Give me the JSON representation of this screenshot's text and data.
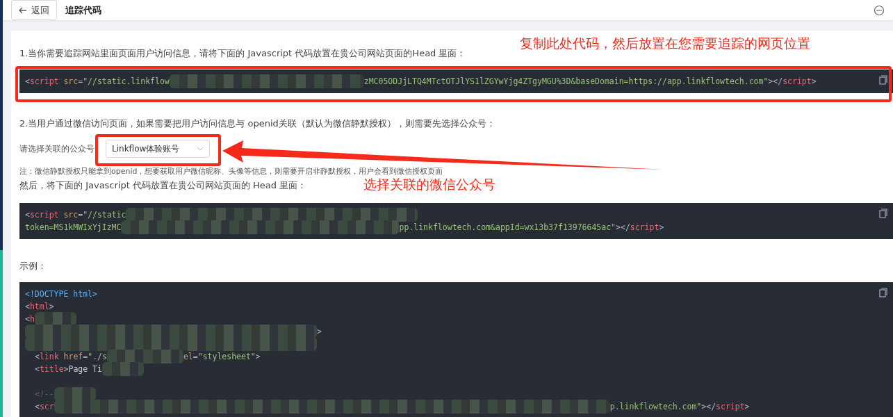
{
  "header": {
    "back_label": "返回",
    "title": "追踪代码"
  },
  "step1": {
    "text": "1.当你需要追踪网站里面页面用户访问信息，请将下面的 Javascript 代码放置在贵公司网站页面的Head 里面：",
    "code": [
      [
        {
          "kind": "punct",
          "text": "<"
        },
        {
          "kind": "tag",
          "text": "script"
        },
        {
          "kind": "attr",
          "text": " src"
        },
        {
          "kind": "punct",
          "text": "="
        },
        {
          "kind": "string",
          "text": "\"//static.linkflow"
        },
        {
          "kind": "redacted"
        },
        {
          "kind": "string",
          "text": "zMC05ODJjLTQ4MTctOTJlYS1lZGYwYjg4ZTgyMGU%3D&baseDomain=https://app.linkflowtech.com\""
        },
        {
          "kind": "punct",
          "text": "></"
        },
        {
          "kind": "tag",
          "text": "script"
        },
        {
          "kind": "punct",
          "text": ">"
        }
      ]
    ]
  },
  "step2": {
    "text": "2.当用户通过微信访问页面，如果需要把用户访问信息与 openid关联（默认为微信静默授权），则需要先选择公众号：",
    "select_label": "请选择关联的公众号",
    "select_value": "Linkflow体验账号",
    "note": "注：微信静默授权只能拿到openid，想要获取用户微信昵称、头像等信息，则需要开启非静默授权，用户会看到微信授权页面",
    "then": "然后，将下面的 Javascript 代码放置在贵公司网站页面的 Head 里面：",
    "code": [
      [
        {
          "kind": "punct",
          "text": "<"
        },
        {
          "kind": "tag",
          "text": "script"
        },
        {
          "kind": "attr",
          "text": " src"
        },
        {
          "kind": "punct",
          "text": "="
        },
        {
          "kind": "string",
          "text": "\"//static"
        },
        {
          "kind": "redacted"
        }
      ],
      [
        {
          "kind": "string",
          "text": "token=MS1kMWIxYjIzMC"
        },
        {
          "kind": "redacted"
        },
        {
          "kind": "string",
          "text": "pp.linkflowtech.com&appId=wx13b37f13976645ac\""
        },
        {
          "kind": "punct",
          "text": "></"
        },
        {
          "kind": "tag",
          "text": "script"
        },
        {
          "kind": "punct",
          "text": ">"
        }
      ]
    ]
  },
  "example": {
    "label": "示例：",
    "code": [
      [
        {
          "kind": "doctype",
          "text": "<!DOCTYPE html>"
        }
      ],
      [
        {
          "kind": "punct",
          "text": "<"
        },
        {
          "kind": "tag",
          "text": "html"
        },
        {
          "kind": "punct",
          "text": ">"
        }
      ],
      [
        {
          "kind": "punct",
          "text": "<"
        },
        {
          "kind": "tag",
          "text": "h"
        },
        {
          "kind": "redacted"
        }
      ],
      [
        {
          "kind": "redacted"
        },
        {
          "kind": "punct",
          "text": ">"
        }
      ],
      [
        {
          "kind": "redacted"
        }
      ],
      [
        {
          "kind": "indent"
        },
        {
          "kind": "punct",
          "text": "<"
        },
        {
          "kind": "tag",
          "text": "link"
        },
        {
          "kind": "attr",
          "text": " href"
        },
        {
          "kind": "punct",
          "text": "="
        },
        {
          "kind": "string",
          "text": "\"./s"
        },
        {
          "kind": "redacted"
        },
        {
          "kind": "attr",
          "text": "el"
        },
        {
          "kind": "punct",
          "text": "="
        },
        {
          "kind": "string",
          "text": "\"stylesheet\""
        },
        {
          "kind": "punct",
          "text": ">"
        }
      ],
      [
        {
          "kind": "indent"
        },
        {
          "kind": "punct",
          "text": "<"
        },
        {
          "kind": "tag",
          "text": "title"
        },
        {
          "kind": "punct",
          "text": ">"
        },
        {
          "kind": "plain",
          "text": "Page Ti"
        },
        {
          "kind": "redacted"
        }
      ],
      [
        {
          "kind": "blank"
        }
      ],
      [
        {
          "kind": "indent"
        },
        {
          "kind": "comment",
          "text": "<!--"
        },
        {
          "kind": "redacted"
        }
      ],
      [
        {
          "kind": "indent"
        },
        {
          "kind": "punct",
          "text": "<"
        },
        {
          "kind": "tag",
          "text": "scr"
        },
        {
          "kind": "redacted"
        },
        {
          "kind": "string",
          "text": "p.linkflowtech.com\""
        },
        {
          "kind": "punct",
          "text": "></"
        },
        {
          "kind": "tag",
          "text": "script"
        },
        {
          "kind": "punct",
          "text": ">"
        }
      ]
    ]
  },
  "annotations": [
    {
      "kind": "callout",
      "text": "复制此处代码，然后放置在您需要追踪的网页位置"
    },
    {
      "kind": "callout",
      "text": "选择关联的微信公众号"
    }
  ]
}
